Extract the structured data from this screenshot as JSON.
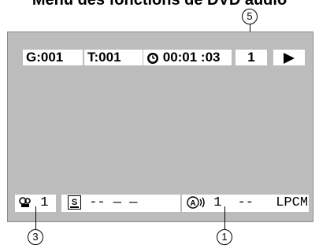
{
  "title": "Menu des fonctions de DVD audio",
  "callouts": {
    "top": "5",
    "bottom_left": "3",
    "bottom_right": "1"
  },
  "top_bar": {
    "group": "G:001",
    "track": "T:001",
    "time": "00:01 :03",
    "page": "1"
  },
  "bottom_bar": {
    "angle_value": "1",
    "subtitle_value": "-- — —",
    "audio_value": "1",
    "audio_dashes": "--",
    "audio_format": "LPCM"
  },
  "icons": {
    "clock": "clock-icon",
    "play": "play-icon",
    "angle": "angle-camera-icon",
    "subtitle": "subtitle-icon",
    "audio": "audio-icon"
  }
}
